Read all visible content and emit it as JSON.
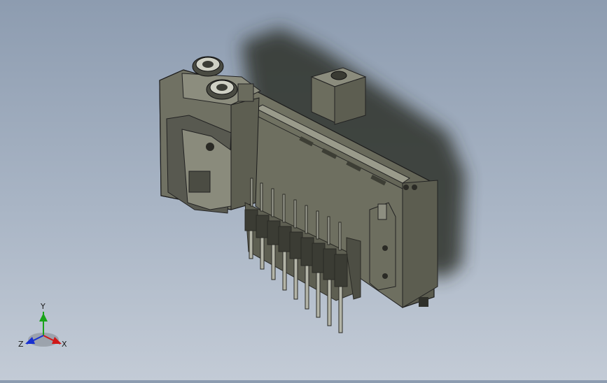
{
  "viewport": {
    "background_top": "#8d9cb0",
    "background_bottom": "#c3cbd6",
    "model_color": "#6f7060",
    "model_shadow": "#3a3b36"
  },
  "triad": {
    "x_label": "X",
    "y_label": "Y",
    "z_label": "Z",
    "x_color": "#d01818",
    "y_color": "#19a319",
    "z_color": "#1830d0"
  }
}
